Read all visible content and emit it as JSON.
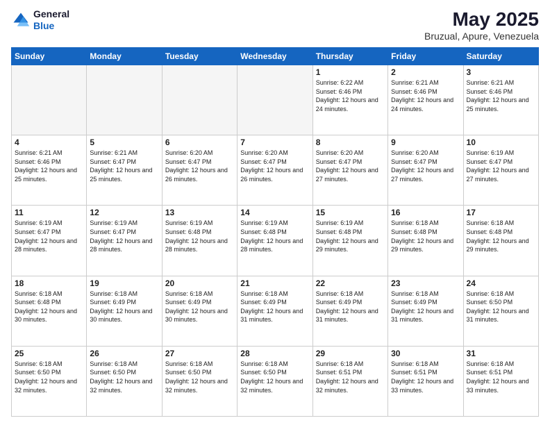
{
  "header": {
    "logo_line1": "General",
    "logo_line2": "Blue",
    "month": "May 2025",
    "location": "Bruzual, Apure, Venezuela"
  },
  "weekdays": [
    "Sunday",
    "Monday",
    "Tuesday",
    "Wednesday",
    "Thursday",
    "Friday",
    "Saturday"
  ],
  "weeks": [
    [
      {
        "day": "",
        "info": ""
      },
      {
        "day": "",
        "info": ""
      },
      {
        "day": "",
        "info": ""
      },
      {
        "day": "",
        "info": ""
      },
      {
        "day": "1",
        "info": "Sunrise: 6:22 AM\nSunset: 6:46 PM\nDaylight: 12 hours\nand 24 minutes."
      },
      {
        "day": "2",
        "info": "Sunrise: 6:21 AM\nSunset: 6:46 PM\nDaylight: 12 hours\nand 24 minutes."
      },
      {
        "day": "3",
        "info": "Sunrise: 6:21 AM\nSunset: 6:46 PM\nDaylight: 12 hours\nand 25 minutes."
      }
    ],
    [
      {
        "day": "4",
        "info": "Sunrise: 6:21 AM\nSunset: 6:46 PM\nDaylight: 12 hours\nand 25 minutes."
      },
      {
        "day": "5",
        "info": "Sunrise: 6:21 AM\nSunset: 6:47 PM\nDaylight: 12 hours\nand 25 minutes."
      },
      {
        "day": "6",
        "info": "Sunrise: 6:20 AM\nSunset: 6:47 PM\nDaylight: 12 hours\nand 26 minutes."
      },
      {
        "day": "7",
        "info": "Sunrise: 6:20 AM\nSunset: 6:47 PM\nDaylight: 12 hours\nand 26 minutes."
      },
      {
        "day": "8",
        "info": "Sunrise: 6:20 AM\nSunset: 6:47 PM\nDaylight: 12 hours\nand 27 minutes."
      },
      {
        "day": "9",
        "info": "Sunrise: 6:20 AM\nSunset: 6:47 PM\nDaylight: 12 hours\nand 27 minutes."
      },
      {
        "day": "10",
        "info": "Sunrise: 6:19 AM\nSunset: 6:47 PM\nDaylight: 12 hours\nand 27 minutes."
      }
    ],
    [
      {
        "day": "11",
        "info": "Sunrise: 6:19 AM\nSunset: 6:47 PM\nDaylight: 12 hours\nand 28 minutes."
      },
      {
        "day": "12",
        "info": "Sunrise: 6:19 AM\nSunset: 6:47 PM\nDaylight: 12 hours\nand 28 minutes."
      },
      {
        "day": "13",
        "info": "Sunrise: 6:19 AM\nSunset: 6:48 PM\nDaylight: 12 hours\nand 28 minutes."
      },
      {
        "day": "14",
        "info": "Sunrise: 6:19 AM\nSunset: 6:48 PM\nDaylight: 12 hours\nand 28 minutes."
      },
      {
        "day": "15",
        "info": "Sunrise: 6:19 AM\nSunset: 6:48 PM\nDaylight: 12 hours\nand 29 minutes."
      },
      {
        "day": "16",
        "info": "Sunrise: 6:18 AM\nSunset: 6:48 PM\nDaylight: 12 hours\nand 29 minutes."
      },
      {
        "day": "17",
        "info": "Sunrise: 6:18 AM\nSunset: 6:48 PM\nDaylight: 12 hours\nand 29 minutes."
      }
    ],
    [
      {
        "day": "18",
        "info": "Sunrise: 6:18 AM\nSunset: 6:48 PM\nDaylight: 12 hours\nand 30 minutes."
      },
      {
        "day": "19",
        "info": "Sunrise: 6:18 AM\nSunset: 6:49 PM\nDaylight: 12 hours\nand 30 minutes."
      },
      {
        "day": "20",
        "info": "Sunrise: 6:18 AM\nSunset: 6:49 PM\nDaylight: 12 hours\nand 30 minutes."
      },
      {
        "day": "21",
        "info": "Sunrise: 6:18 AM\nSunset: 6:49 PM\nDaylight: 12 hours\nand 31 minutes."
      },
      {
        "day": "22",
        "info": "Sunrise: 6:18 AM\nSunset: 6:49 PM\nDaylight: 12 hours\nand 31 minutes."
      },
      {
        "day": "23",
        "info": "Sunrise: 6:18 AM\nSunset: 6:49 PM\nDaylight: 12 hours\nand 31 minutes."
      },
      {
        "day": "24",
        "info": "Sunrise: 6:18 AM\nSunset: 6:50 PM\nDaylight: 12 hours\nand 31 minutes."
      }
    ],
    [
      {
        "day": "25",
        "info": "Sunrise: 6:18 AM\nSunset: 6:50 PM\nDaylight: 12 hours\nand 32 minutes."
      },
      {
        "day": "26",
        "info": "Sunrise: 6:18 AM\nSunset: 6:50 PM\nDaylight: 12 hours\nand 32 minutes."
      },
      {
        "day": "27",
        "info": "Sunrise: 6:18 AM\nSunset: 6:50 PM\nDaylight: 12 hours\nand 32 minutes."
      },
      {
        "day": "28",
        "info": "Sunrise: 6:18 AM\nSunset: 6:50 PM\nDaylight: 12 hours\nand 32 minutes."
      },
      {
        "day": "29",
        "info": "Sunrise: 6:18 AM\nSunset: 6:51 PM\nDaylight: 12 hours\nand 32 minutes."
      },
      {
        "day": "30",
        "info": "Sunrise: 6:18 AM\nSunset: 6:51 PM\nDaylight: 12 hours\nand 33 minutes."
      },
      {
        "day": "31",
        "info": "Sunrise: 6:18 AM\nSunset: 6:51 PM\nDaylight: 12 hours\nand 33 minutes."
      }
    ]
  ]
}
